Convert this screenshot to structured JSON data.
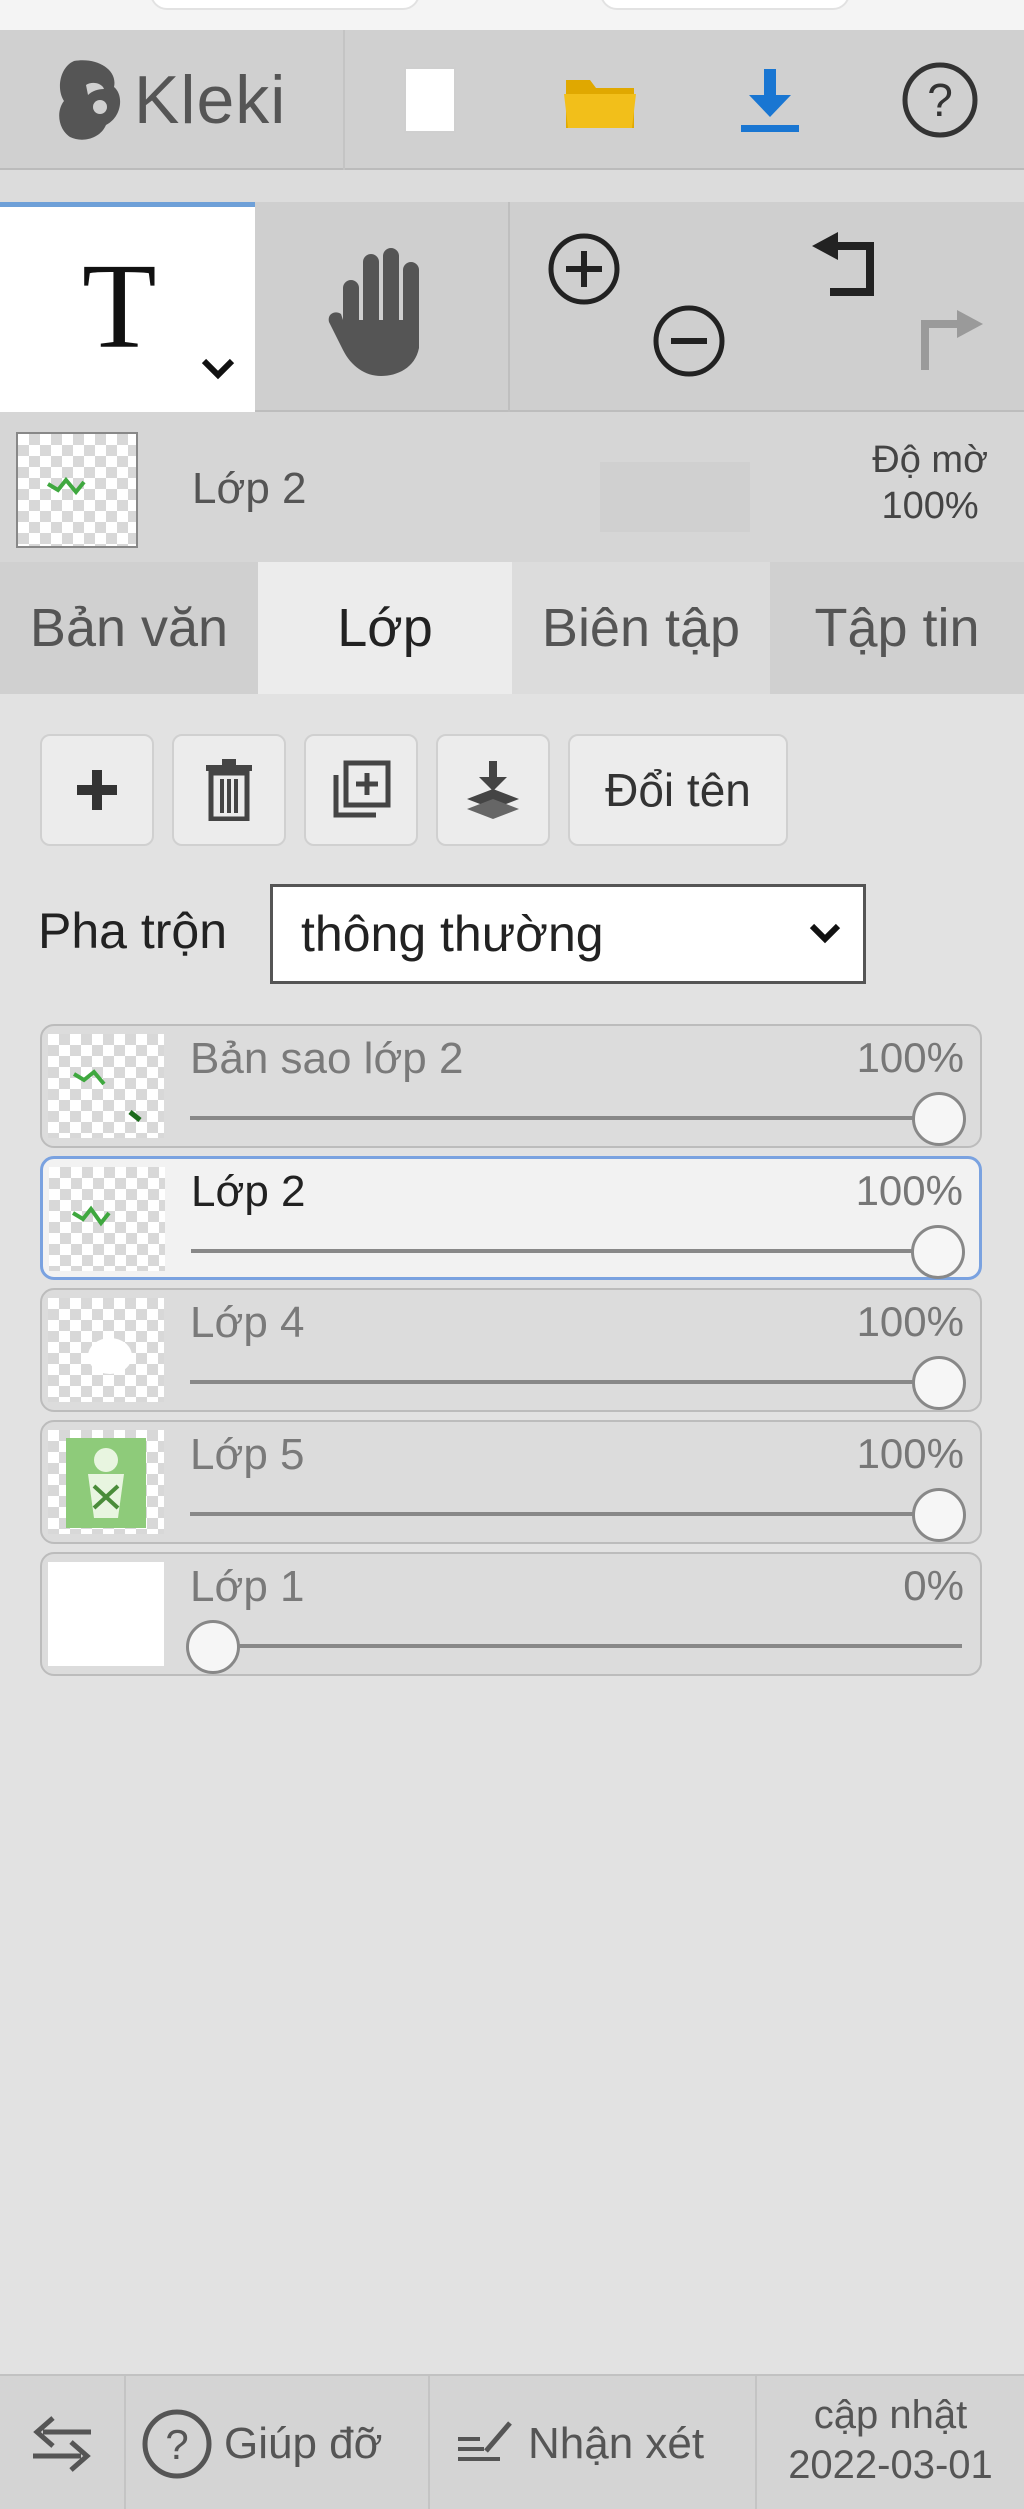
{
  "header": {
    "app_name": "Kleki",
    "buttons": [
      {
        "id": "new",
        "icon": "new-file-icon"
      },
      {
        "id": "open",
        "icon": "folder-icon"
      },
      {
        "id": "save",
        "icon": "download-icon"
      },
      {
        "id": "help",
        "icon": "help-circle-icon"
      }
    ],
    "colors": {
      "folder": "#f0b800",
      "download": "#1976d2",
      "accent": "#6ea0d8"
    }
  },
  "toolbar": {
    "text_tool_glyph": "T",
    "tools": [
      "text-tool",
      "hand-tool",
      "zoom-in",
      "zoom-out",
      "undo",
      "redo"
    ]
  },
  "current_layer": {
    "name": "Lớp 2",
    "opacity_label": "Độ mờ",
    "opacity_value": "100%"
  },
  "tabs": [
    {
      "label": "Bản văn",
      "active": false
    },
    {
      "label": "Lớp",
      "active": true
    },
    {
      "label": "Biên tập",
      "active": false
    },
    {
      "label": "Tập tin",
      "active": false
    }
  ],
  "layer_actions": {
    "add_icon": "plus-icon",
    "delete_icon": "trash-icon",
    "duplicate_icon": "duplicate-icon",
    "merge_icon": "merge-down-icon",
    "rename_label": "Đổi tên"
  },
  "blend": {
    "label": "Pha trộn",
    "value": "thông thường"
  },
  "layers": [
    {
      "name": "Bản sao lớp 2",
      "opacity": "100%",
      "opacity_value": 1.0,
      "selected": false
    },
    {
      "name": "Lớp 2",
      "opacity": "100%",
      "opacity_value": 1.0,
      "selected": true
    },
    {
      "name": "Lớp 4",
      "opacity": "100%",
      "opacity_value": 1.0,
      "selected": false
    },
    {
      "name": "Lớp 5",
      "opacity": "100%",
      "opacity_value": 1.0,
      "selected": false
    },
    {
      "name": "Lớp 1",
      "opacity": "0%",
      "opacity_value": 0.0,
      "selected": false
    }
  ],
  "footer": {
    "swap_icon": "swap-arrows-icon",
    "help_label": "Giúp đỡ",
    "feedback_label": "Nhận xét",
    "update_label": "cập nhật",
    "update_date": "2022-03-01"
  }
}
